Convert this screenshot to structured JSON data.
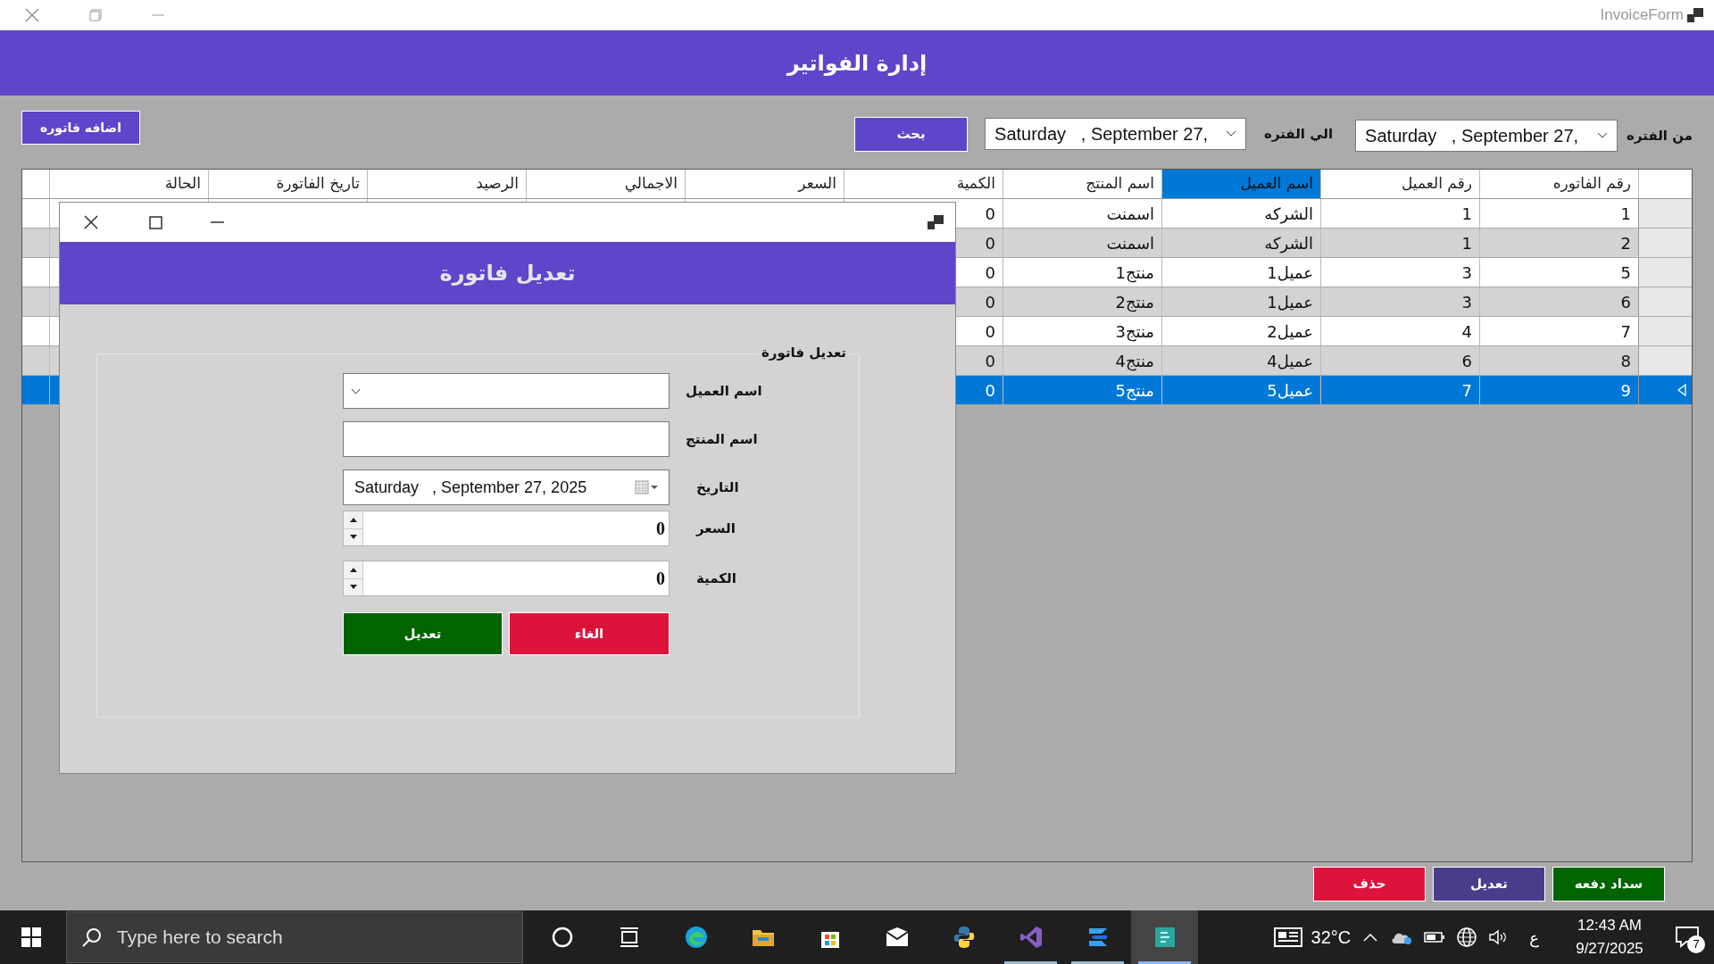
{
  "window": {
    "title": "InvoiceForm"
  },
  "header": {
    "title": "إدارة الفواتير"
  },
  "toolbar": {
    "add_button": "اضافه فاتوره",
    "from_label": "من الفتره",
    "from_date": "Saturday   , September 27,",
    "to_label": "الي الفتره",
    "to_date": "Saturday   , September 27,",
    "search_button": "بحث"
  },
  "table": {
    "columns": [
      {
        "label": "رقم الفاتوره",
        "selected": false
      },
      {
        "label": "رقم العميل",
        "selected": false
      },
      {
        "label": "اسم العميل",
        "selected": true
      },
      {
        "label": "اسم المنتج",
        "selected": false
      },
      {
        "label": "الكمية",
        "selected": false
      },
      {
        "label": "السعر",
        "selected": false
      },
      {
        "label": "الاجمالي",
        "selected": false
      },
      {
        "label": "الرصيد",
        "selected": false
      },
      {
        "label": "تاريخ الفاتورة",
        "selected": false
      },
      {
        "label": "الحالة",
        "selected": false
      }
    ],
    "rows": [
      {
        "cells": [
          "1",
          "1",
          "الشركه",
          "اسمنت",
          "0"
        ],
        "selected": false
      },
      {
        "cells": [
          "2",
          "1",
          "الشركه",
          "اسمنت",
          "0"
        ],
        "selected": false
      },
      {
        "cells": [
          "5",
          "3",
          "عميل1",
          "منتج1",
          "0"
        ],
        "selected": false
      },
      {
        "cells": [
          "6",
          "3",
          "عميل1",
          "منتج2",
          "0"
        ],
        "selected": false
      },
      {
        "cells": [
          "7",
          "4",
          "عميل2",
          "منتج3",
          "0"
        ],
        "selected": false
      },
      {
        "cells": [
          "8",
          "6",
          "عميل4",
          "منتج4",
          "0"
        ],
        "selected": false
      },
      {
        "cells": [
          "9",
          "7",
          "عميل5",
          "منتج5",
          "0"
        ],
        "selected": true
      }
    ]
  },
  "dialog": {
    "title": "تعديل فاتورة",
    "group_title": "تعديل فاتورة",
    "fields": [
      {
        "kind": "combo",
        "label": "اسم العميل"
      },
      {
        "kind": "text",
        "label": "اسم المنتج"
      },
      {
        "kind": "date",
        "label": "التاريخ",
        "value": "Saturday   , September 27, 2025"
      },
      {
        "kind": "number",
        "label": "السعر",
        "value": "0"
      },
      {
        "kind": "number",
        "label": "الكمية",
        "value": "0"
      }
    ],
    "edit_button": "تعديل",
    "cancel_button": "الغاء"
  },
  "bottom_buttons": [
    {
      "kind": "pay",
      "label": "سداد دفعه"
    },
    {
      "kind": "edit",
      "label": "تعديل"
    },
    {
      "kind": "delete",
      "label": "حذف"
    }
  ],
  "taskbar": {
    "search_placeholder": "Type here to search",
    "apps": [
      {
        "kind": "cortana",
        "running": false,
        "active": false
      },
      {
        "kind": "taskview",
        "running": false,
        "active": false
      },
      {
        "kind": "edge",
        "running": false,
        "active": false
      },
      {
        "kind": "folder",
        "running": false,
        "active": false
      },
      {
        "kind": "store",
        "running": false,
        "active": false
      },
      {
        "kind": "mail",
        "running": false,
        "active": false
      },
      {
        "kind": "python",
        "running": false,
        "active": false
      },
      {
        "kind": "vs",
        "running": true,
        "active": false
      },
      {
        "kind": "blue",
        "running": true,
        "active": false
      },
      {
        "kind": "app",
        "running": true,
        "active": true
      }
    ],
    "temperature": "32°C",
    "language": "ع",
    "time": "12:43 AM",
    "date": "9/27/2025",
    "notifications": "7"
  }
}
